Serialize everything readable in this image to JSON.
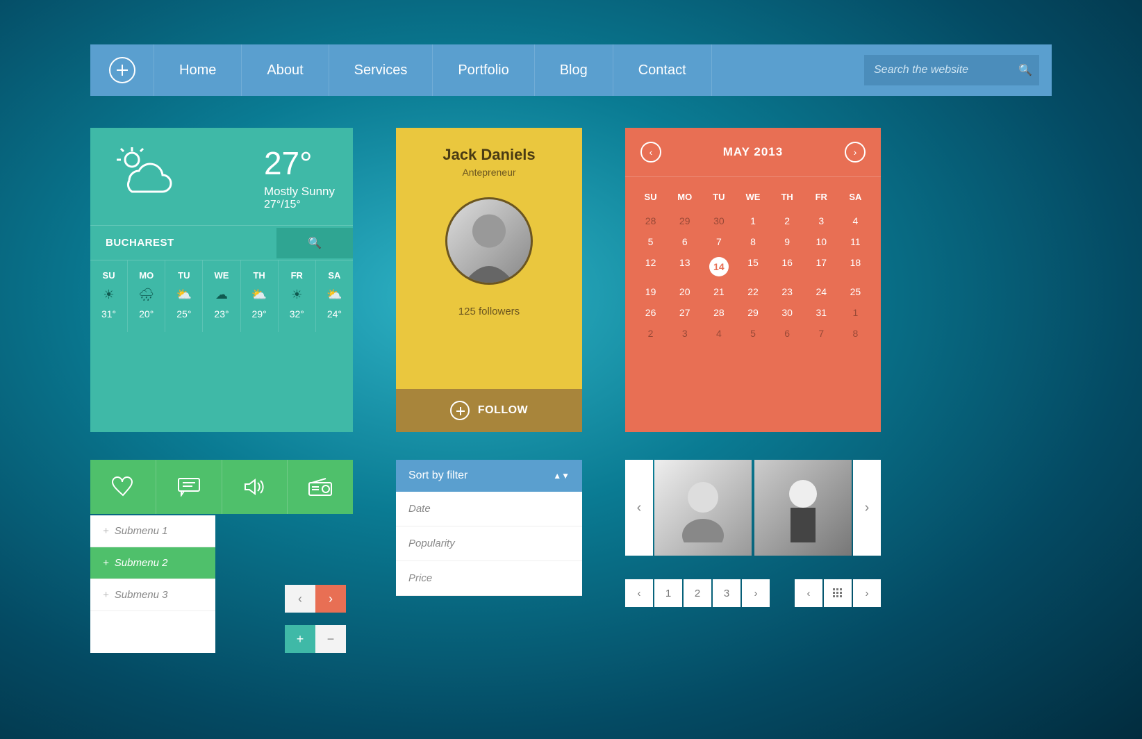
{
  "nav": {
    "items": [
      "Home",
      "About",
      "Services",
      "Portfolio",
      "Blog",
      "Contact"
    ],
    "search_placeholder": "Search the website"
  },
  "weather": {
    "temp": "27°",
    "condition": "Mostly Sunny",
    "range": "27°/15°",
    "city": "BUCHAREST",
    "days": [
      {
        "label": "SU",
        "temp": "31°"
      },
      {
        "label": "MO",
        "temp": "20°"
      },
      {
        "label": "TU",
        "temp": "25°"
      },
      {
        "label": "WE",
        "temp": "23°"
      },
      {
        "label": "TH",
        "temp": "29°"
      },
      {
        "label": "FR",
        "temp": "32°"
      },
      {
        "label": "SA",
        "temp": "24°"
      }
    ]
  },
  "profile": {
    "name": "Jack Daniels",
    "role": "Antepreneur",
    "followers": "125 followers",
    "follow_label": "FOLLOW"
  },
  "calendar": {
    "title": "MAY 2013",
    "dow": [
      "SU",
      "MO",
      "TU",
      "WE",
      "TH",
      "FR",
      "SA"
    ],
    "rows": [
      [
        {
          "n": "28",
          "dim": true
        },
        {
          "n": "29",
          "dim": true
        },
        {
          "n": "30",
          "dim": true
        },
        {
          "n": "1"
        },
        {
          "n": "2"
        },
        {
          "n": "3"
        },
        {
          "n": "4"
        }
      ],
      [
        {
          "n": "5"
        },
        {
          "n": "6"
        },
        {
          "n": "7"
        },
        {
          "n": "8"
        },
        {
          "n": "9"
        },
        {
          "n": "10"
        },
        {
          "n": "11"
        }
      ],
      [
        {
          "n": "12"
        },
        {
          "n": "13"
        },
        {
          "n": "14",
          "sel": true
        },
        {
          "n": "15"
        },
        {
          "n": "16"
        },
        {
          "n": "17"
        },
        {
          "n": "18"
        }
      ],
      [
        {
          "n": "19"
        },
        {
          "n": "20"
        },
        {
          "n": "21"
        },
        {
          "n": "22"
        },
        {
          "n": "23"
        },
        {
          "n": "24"
        },
        {
          "n": "25"
        }
      ],
      [
        {
          "n": "26"
        },
        {
          "n": "27"
        },
        {
          "n": "28"
        },
        {
          "n": "29"
        },
        {
          "n": "30"
        },
        {
          "n": "31"
        },
        {
          "n": "1",
          "dim": true
        }
      ],
      [
        {
          "n": "2",
          "dim": true
        },
        {
          "n": "3",
          "dim": true
        },
        {
          "n": "4",
          "dim": true
        },
        {
          "n": "5",
          "dim": true
        },
        {
          "n": "6",
          "dim": true
        },
        {
          "n": "7",
          "dim": true
        },
        {
          "n": "8",
          "dim": true
        }
      ]
    ]
  },
  "tabs": {
    "submenu": [
      "Submenu 1",
      "Submenu 2",
      "Submenu 3"
    ],
    "active_index": 1
  },
  "sort": {
    "label": "Sort by filter",
    "options": [
      "Date",
      "Popularity",
      "Price"
    ]
  },
  "pagination": {
    "pages": [
      "1",
      "2",
      "3"
    ]
  }
}
